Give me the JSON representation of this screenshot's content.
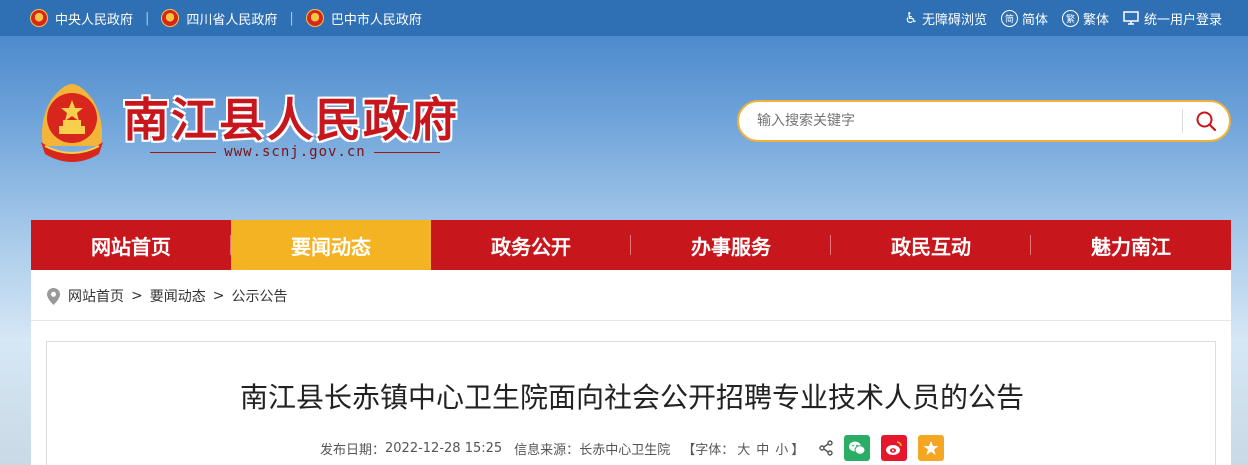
{
  "topbar": {
    "links": [
      {
        "label": "中央人民政府"
      },
      {
        "label": "四川省人民政府"
      },
      {
        "label": "巴中市人民政府"
      }
    ],
    "separator": "|",
    "accessibility": "无障碍浏览",
    "simplified": "简体",
    "traditional": "繁体",
    "login": "统一用户登录",
    "simplified_glyph": "简",
    "traditional_glyph": "繁"
  },
  "header": {
    "site_title": "南江县人民政府",
    "site_url": "www.scnj.gov.cn"
  },
  "search": {
    "placeholder": "输入搜索关键字"
  },
  "nav": {
    "tabs": [
      {
        "label": "网站首页",
        "active": false
      },
      {
        "label": "要闻动态",
        "active": true
      },
      {
        "label": "政务公开",
        "active": false
      },
      {
        "label": "办事服务",
        "active": false
      },
      {
        "label": "政民互动",
        "active": false
      },
      {
        "label": "魅力南江",
        "active": false
      }
    ]
  },
  "breadcrumb": {
    "items": [
      "网站首页",
      "要闻动态",
      "公示公告"
    ],
    "separator": ">"
  },
  "article": {
    "title": "南江县长赤镇中心卫生院面向社会公开招聘专业技术人员的公告",
    "publish_label": "发布日期：",
    "publish_date": "2022-12-28 15:25",
    "source_label": "信息来源：",
    "source": "长赤中心卫生院",
    "font_label": "【字体：",
    "font_large": "大",
    "font_medium": "中",
    "font_small": "小",
    "font_close": "】"
  },
  "colors": {
    "brand_red": "#c8161d",
    "active_tab": "#f4b322",
    "topbar_blue": "#2f6fb3",
    "search_border": "#f0b13a",
    "wechat": "#2aae67",
    "weibo": "#e6162d",
    "favorite": "#f5a623"
  }
}
